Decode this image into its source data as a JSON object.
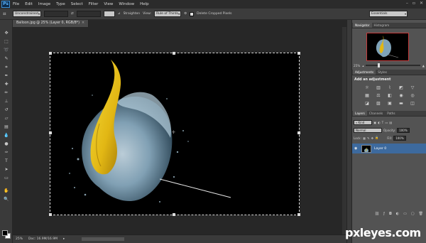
{
  "app": {
    "logo_text": "Ps"
  },
  "menu": [
    "File",
    "Edit",
    "Image",
    "Type",
    "Select",
    "Filter",
    "View",
    "Window",
    "Help"
  ],
  "window_controls": [
    "–",
    "▫",
    "✕"
  ],
  "options_bar": {
    "ratio_value": "Unconstrained",
    "straighten_label": "Straighten",
    "view_label": "View:",
    "view_value": "Rule of Thirds",
    "delete_cropped_label": "Delete Cropped Pixels",
    "workspace_value": "Essentials"
  },
  "document": {
    "tab_title": "Balloon.jpg @ 25% (Layer 0, RGB/8*)",
    "tab_close": "×",
    "zoom": "25%",
    "doc_size": "Doc: 16.9M/16.9M"
  },
  "navigator": {
    "tabs": [
      "Navigator",
      "Histogram"
    ],
    "zoom": "25%"
  },
  "adjustments": {
    "tabs": [
      "Adjustments",
      "Styles"
    ],
    "title": "Add an adjustment"
  },
  "layers": {
    "tabs": [
      "Layers",
      "Channels",
      "Paths"
    ],
    "kind_value": "Kind",
    "blend_mode": "Normal",
    "opacity_label": "Opacity:",
    "opacity_value": "100%",
    "lock_label": "Lock:",
    "fill_label": "Fill:",
    "fill_value": "100%",
    "layer_name": "Layer 0"
  },
  "watermark": "pxleyes.com",
  "colors": {
    "accent": "#3d6a9e",
    "balloon_yellow": "#e8c21a",
    "water_blue": "#8fb2c8"
  }
}
